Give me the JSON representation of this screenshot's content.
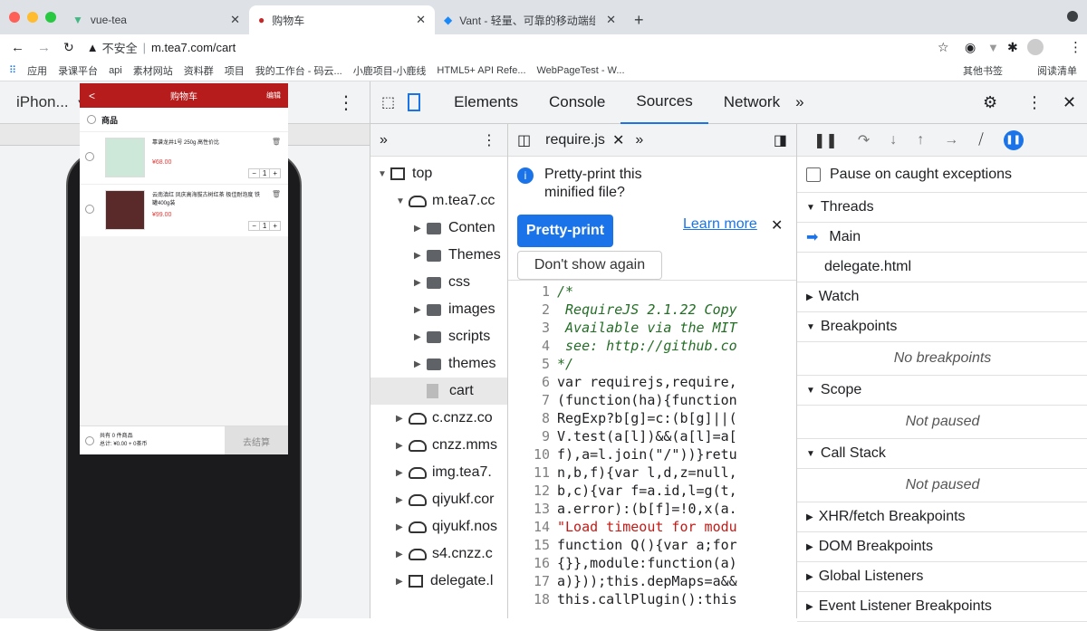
{
  "browser": {
    "tabs": [
      {
        "title": "vue-tea",
        "active": false
      },
      {
        "title": "购物车",
        "active": true
      },
      {
        "title": "Vant - 轻量、可靠的移动端组件",
        "active": false
      }
    ],
    "security": "不安全",
    "url": "m.tea7.com/cart",
    "bookmarks": [
      "应用",
      "录课平台",
      "api",
      "素材网站",
      "资料群",
      "项目",
      "我的工作台 - 码云...",
      "小鹿项目-小鹿线",
      "HTML5+ API Refe...",
      "WebPageTest - W..."
    ],
    "bookmarks_right": [
      "其他书签",
      "阅读清单"
    ]
  },
  "device": {
    "name": "iPhon...",
    "width": "375",
    "height": "667"
  },
  "phone_app": {
    "title": "购物车",
    "edit": "编辑",
    "back": "<",
    "section": "商品",
    "items": [
      {
        "name": "靠谱龙井1号 250g 高性价比",
        "price": "¥68.00",
        "qty": "1"
      },
      {
        "name": "云南滇红 凤庆高海拔古树红茶 极佳耐泡度 铁罐400g装",
        "price": "¥99.00",
        "qty": "1"
      }
    ],
    "footer": {
      "count_line": "共有 0 件商品",
      "total_line": "总计: ¥0.00 + 0茶币",
      "checkout": "去结算"
    }
  },
  "devtools": {
    "tabs": [
      "Elements",
      "Console",
      "Sources",
      "Network"
    ],
    "active_tab": "Sources",
    "tree": [
      {
        "label": "top",
        "kind": "frame",
        "indent": 0
      },
      {
        "label": "m.tea7.cc",
        "kind": "cloud",
        "indent": 1
      },
      {
        "label": "Conten",
        "kind": "folder",
        "indent": 2
      },
      {
        "label": "Themes",
        "kind": "folder",
        "indent": 2
      },
      {
        "label": "css",
        "kind": "folder",
        "indent": 2
      },
      {
        "label": "images",
        "kind": "folder",
        "indent": 2
      },
      {
        "label": "scripts",
        "kind": "folder",
        "indent": 2
      },
      {
        "label": "themes",
        "kind": "folder",
        "indent": 2
      },
      {
        "label": "cart",
        "kind": "file",
        "indent": 2
      },
      {
        "label": "c.cnzz.co",
        "kind": "cloud",
        "indent": 1
      },
      {
        "label": "cnzz.mms",
        "kind": "cloud",
        "indent": 1
      },
      {
        "label": "img.tea7.",
        "kind": "cloud",
        "indent": 1
      },
      {
        "label": "qiyukf.cor",
        "kind": "cloud",
        "indent": 1
      },
      {
        "label": "qiyukf.nos",
        "kind": "cloud",
        "indent": 1
      },
      {
        "label": "s4.cnzz.c",
        "kind": "cloud",
        "indent": 1
      },
      {
        "label": "delegate.l",
        "kind": "frame",
        "indent": 1
      }
    ],
    "file_tab": "require.js",
    "prettyprint": {
      "message": "Pretty-print this minified file?",
      "pretty_btn": "Pretty-print",
      "learn_more": "Learn more",
      "dont_show": "Don't show again"
    },
    "code_lines": [
      "/*",
      " RequireJS 2.1.22 Copy",
      " Available via the MIT",
      " see: http://github.co",
      "*/",
      "var requirejs,require,",
      "(function(ha){function",
      "RegExp?b[g]=c:(b[g]||(",
      "V.test(a[l])&&(a[l]=a[",
      "f),a=l.join(\"/\"))}retu",
      "n,b,f){var l,d,z=null,",
      "b,c){var f=a.id,l=g(t,",
      "a.error):(b[f]=!0,x(a.",
      "\"Load timeout for modu",
      "function Q(){var a;for",
      "{}},module:function(a)",
      "a)}));this.depMaps=a&&",
      "this.callPlugin():this"
    ],
    "debugger": {
      "pause_caught": "Pause on caught exceptions",
      "threads": "Threads",
      "main": "Main",
      "delegate": "delegate.html",
      "watch": "Watch",
      "breakpoints": "Breakpoints",
      "no_breakpoints": "No breakpoints",
      "scope": "Scope",
      "not_paused": "Not paused",
      "call_stack": "Call Stack",
      "not_paused2": "Not paused",
      "xhr": "XHR/fetch Breakpoints",
      "dom": "DOM Breakpoints",
      "global": "Global Listeners",
      "event": "Event Listener Breakpoints"
    }
  },
  "colors": {
    "accent": "#1a73e8",
    "app_red": "#b71c1c",
    "price_red": "#e53935"
  }
}
